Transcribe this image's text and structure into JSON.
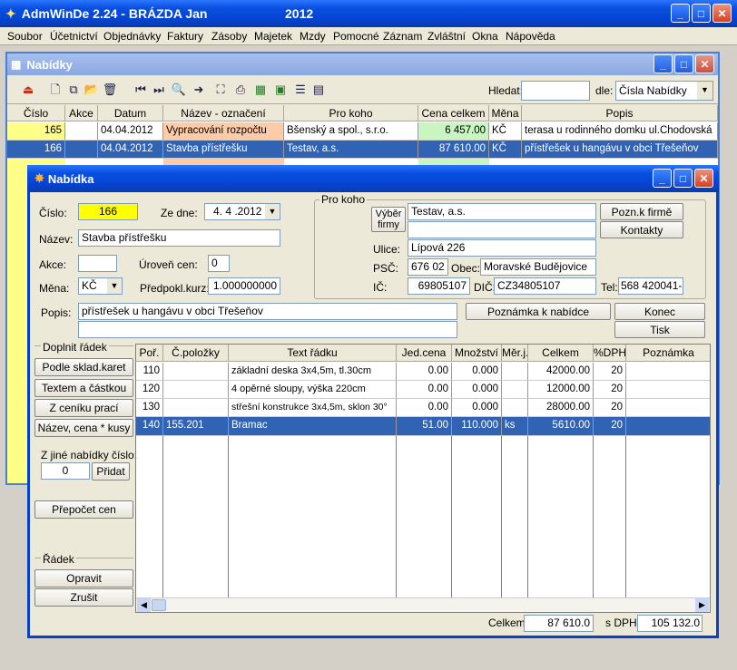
{
  "app": {
    "title": "AdmWinDe 2.24 - BRÁZDA Jan",
    "year": "2012"
  },
  "menu": [
    "Soubor",
    "Účetnictví",
    "Objednávky",
    "Faktury",
    "Zásoby",
    "Majetek",
    "Mzdy",
    "Pomocné",
    "Záznam",
    "Zvláštní",
    "Okna",
    "Nápověda"
  ],
  "list_window": {
    "title": "Nabídky",
    "search_label": "Hledat:",
    "search_value": "",
    "by_label": "dle:",
    "by_value": "Čísla Nabídky",
    "columns": [
      "Číslo",
      "Akce",
      "Datum",
      "Název - označení",
      "Pro koho",
      "Cena celkem",
      "Měna",
      "Popis"
    ],
    "rows": [
      {
        "cislo": "165",
        "akce": "",
        "datum": "04.04.2012",
        "nazev": "Vypracování rozpočtu",
        "pro": "Bšenský a spol., s.r.o.",
        "cena": "6 457.00",
        "mena": "KČ",
        "popis": "terasa u rodinného domku ul.Chodovská"
      },
      {
        "cislo": "166",
        "akce": "",
        "datum": "04.04.2012",
        "nazev": "Stavba přístřešku",
        "pro": "Testav, a.s.",
        "cena": "87 610.00",
        "mena": "KČ",
        "popis": "přístřešek u hangávu v obci Třešeňov"
      }
    ]
  },
  "dialog": {
    "title": "Nabídka",
    "cislo_label": "Číslo:",
    "cislo": "166",
    "ze_dne_label": "Ze dne:",
    "ze_dne": "4. 4 .2012",
    "nazev_label": "Název:",
    "nazev": "Stavba přístřešku",
    "akce_label": "Akce:",
    "akce": "",
    "uroven_label": "Úroveň cen:",
    "uroven": "0",
    "mena_label": "Měna:",
    "mena": "KČ",
    "kurz_label": "Předpokl.kurz:",
    "kurz": "1.000000000",
    "popis_label": "Popis:",
    "popis": "přístřešek u hangávu v obci Třešeňov",
    "popis2": "",
    "pro_koho_label": "Pro koho",
    "vyber_firmy": "Výběr firmy",
    "firma": "Testav, a.s.",
    "firma2": "",
    "ulice_label": "Ulice:",
    "ulice": "Lípová 226",
    "psc_label": "PSČ:",
    "psc": "676 02",
    "obec_label": "Obec:",
    "obec": "Moravské Budějovice",
    "ic_label": "IČ:",
    "ic": "69805107",
    "dic_label": "DIČ:",
    "dic": "CZ34805107",
    "tel_label": "Tel:",
    "tel": "568 420041-",
    "btn_pozn_firme": "Pozn.k firmě",
    "btn_kontakty": "Kontakty",
    "btn_poznamka": "Poznámka k nabídce",
    "btn_konec": "Konec",
    "btn_tisk": "Tisk",
    "doplnit_label": "Doplnit řádek",
    "btn_sklad": "Podle sklad.karet",
    "btn_textem": "Textem a částkou",
    "btn_cenik": "Z ceníku prací",
    "btn_nazev_cena": "Název, cena * kusy",
    "jine_label": "Z jiné nabídky číslo:",
    "jine_value": "0",
    "btn_pridat": "Přidat",
    "btn_prepocet": "Přepočet cen",
    "radek_label": "Řádek",
    "btn_opravit": "Opravit",
    "btn_zrusit": "Zrušit",
    "grid_columns": [
      "Poř.",
      "Č.položky",
      "Text řádku",
      "Jed.cena",
      "Množství",
      "Měr.j.",
      "Celkem",
      "%DPH",
      "Poznámka"
    ],
    "grid_rows": [
      {
        "por": "110",
        "pol": "",
        "text": "základní deska 3x4,5m, tl.30cm",
        "cena": "0.00",
        "mnoz": "0.000",
        "mj": "",
        "celkem": "42000.00",
        "dph": "20",
        "pozn": ""
      },
      {
        "por": "120",
        "pol": "",
        "text": "4 opěrné sloupy, výška 220cm",
        "cena": "0.00",
        "mnoz": "0.000",
        "mj": "",
        "celkem": "12000.00",
        "dph": "20",
        "pozn": ""
      },
      {
        "por": "130",
        "pol": "",
        "text": "střešní konstrukce 3x4,5m, sklon 30°",
        "cena": "0.00",
        "mnoz": "0.000",
        "mj": "",
        "celkem": "28000.00",
        "dph": "20",
        "pozn": ""
      },
      {
        "por": "140",
        "pol": "155.201",
        "text": "Bramac",
        "cena": "51.00",
        "mnoz": "110.000",
        "mj": "ks",
        "celkem": "5610.00",
        "dph": "20",
        "pozn": ""
      }
    ],
    "celkem_label": "Celkem:",
    "celkem": "87 610.0",
    "s_dph_label": "s DPH:",
    "s_dph": "105 132.0"
  }
}
